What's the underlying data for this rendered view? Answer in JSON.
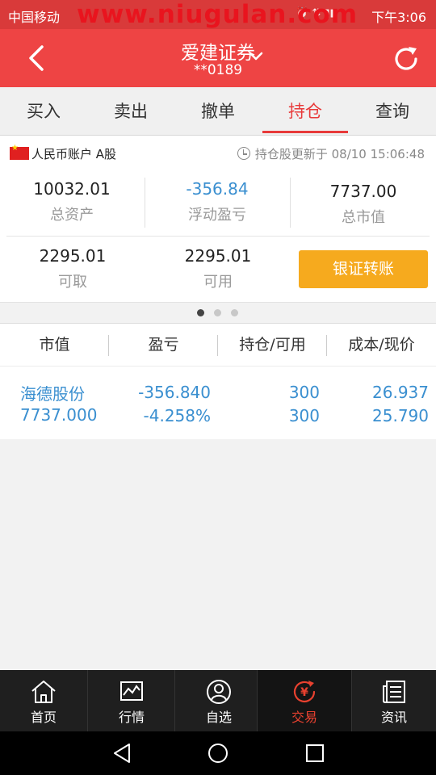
{
  "status_bar": {
    "carrier": "中国移动",
    "watermark": "www.niugulan.com",
    "time": "下午3:06"
  },
  "header": {
    "title": "爱建证券",
    "account": "**0189",
    "icons": [
      "back-arrow-icon",
      "chevron-down-icon",
      "refresh-icon"
    ]
  },
  "tabs": [
    "买入",
    "卖出",
    "撤单",
    "持仓",
    "查询"
  ],
  "active_tab": "持仓",
  "account_panel": {
    "account_label": "人民币账户 A股",
    "update_text": "持仓股更新于 08/10 15:06:48",
    "total_assets": {
      "value": "10032.01",
      "label": "总资产"
    },
    "floating_pl": {
      "value": "-356.84",
      "label": "浮动盈亏"
    },
    "market_value": {
      "value": "7737.00",
      "label": "总市值"
    },
    "withdrawable": {
      "value": "2295.01",
      "label": "可取"
    },
    "available": {
      "value": "2295.01",
      "label": "可用"
    },
    "transfer_button": "银证转账",
    "page_dots": {
      "count": 3,
      "active": 1
    }
  },
  "holdings": {
    "columns": [
      "市值",
      "盈亏",
      "持仓/可用",
      "成本/现价"
    ],
    "rows": [
      {
        "name": "海德股份",
        "market_value": "7737.000",
        "pl": "-356.840",
        "pl_pct": "-4.258%",
        "position": "300",
        "available": "300",
        "cost": "26.937",
        "price": "25.790"
      }
    ]
  },
  "bottom_nav": {
    "items": [
      {
        "label": "首页",
        "icon": "home-icon"
      },
      {
        "label": "行情",
        "icon": "chart-icon"
      },
      {
        "label": "自选",
        "icon": "user-icon"
      },
      {
        "label": "交易",
        "icon": "yuan-icon"
      },
      {
        "label": "资讯",
        "icon": "news-icon"
      }
    ],
    "active": "交易"
  },
  "colors": {
    "header": "#ee4444",
    "status_bar": "#d93a3a",
    "accent": "#e83a3a",
    "value_blue": "#3a8fd0",
    "transfer_button": "#f6aa1e"
  }
}
